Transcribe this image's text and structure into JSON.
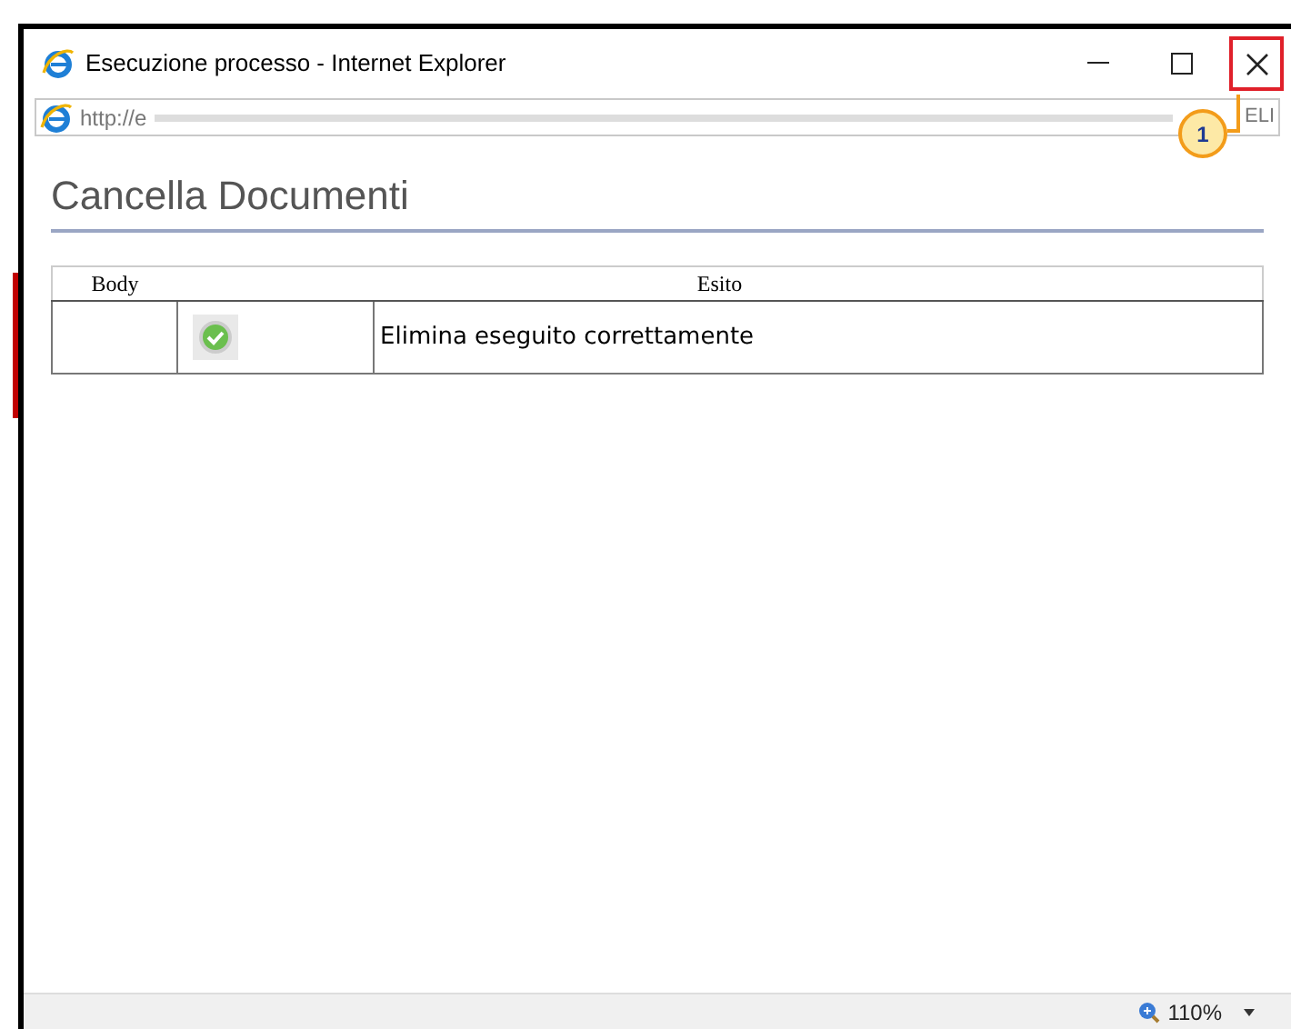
{
  "window": {
    "title": "Esecuzione processo - Internet Explorer"
  },
  "address_bar": {
    "url_start": "http://e",
    "url_end": "ELI"
  },
  "callout": {
    "label": "1"
  },
  "page": {
    "heading": "Cancella Documenti"
  },
  "table": {
    "columns": [
      "Body",
      "Esito"
    ],
    "rows": [
      {
        "body": "",
        "kind": "success",
        "message": "Elimina eseguito correttamente"
      }
    ]
  },
  "status_bar": {
    "zoom": "110%"
  }
}
